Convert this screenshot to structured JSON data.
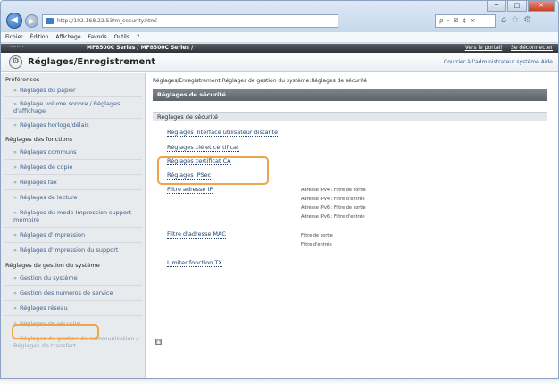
{
  "browser": {
    "url": "http://192.168.22.53/m_security.html",
    "search_text": "ρ - ☒ ¢ ×",
    "window_controls": [
      "─",
      "□",
      "✕"
    ],
    "icons": [
      "home-icon",
      "star-icon",
      "gear-icon"
    ],
    "icon_glyphs": [
      "⌂",
      "☆",
      "⚙"
    ]
  },
  "menu": [
    "Fichier",
    "Édition",
    "Affichage",
    "Favoris",
    "Outils",
    "?"
  ],
  "brand_bar": {
    "device_name": "········",
    "model": "MF8500C Series / MF8500C Series /",
    "links": [
      "Vers le portail",
      "Se déconnecter"
    ]
  },
  "page_header": {
    "title": "Réglages/Enregistrement",
    "right_text": "Courrier à l'administrateur système  Aide"
  },
  "sidebar": {
    "sections": [
      {
        "title": "Préférences",
        "items": [
          "Réglages du papier",
          "Réglage volume sonore / Réglages d'affichage",
          "Réglages horloge/délais"
        ]
      },
      {
        "title": "Réglages des fonctions",
        "items": [
          "Réglages communs",
          "Réglages de copie",
          "Réglages fax",
          "Réglages de lecture",
          "Réglages du mode Impression support mémoire",
          "Réglages d'impression",
          "Réglages d'impression du support"
        ]
      },
      {
        "title": "Réglages de gestion du système",
        "items": [
          "Gestion du système",
          "Gestion des numéros de service",
          "Réglages réseau",
          "Réglages de sécurité",
          "Réglages de gestion de communication / Réglages de transfert"
        ]
      }
    ]
  },
  "main": {
    "breadcrumb": "Réglages/Enregistrement:Réglages de gestion du système:Réglages de sécurité",
    "header_bar": "Réglages de sécurité",
    "sub_bar": "Réglages de sécurité",
    "links": [
      "Réglages interface utilisateur distante",
      "Réglages clé et certificat",
      "Réglages certificat CA",
      "Réglages IPSec",
      "Filtre adresse IP",
      "Filtre d'adresse MAC",
      "Limiter fonction TX"
    ],
    "ip_filter_values": [
      "Adresse IPv4 : Filtre de sortie",
      "Adresse IPv4 : Filtre d'entrée",
      "Adresse IPv6 : Filtre de sortie",
      "Adresse IPv6 : Filtre d'entrée"
    ],
    "mac_filter_values": [
      "Filtre de sortie",
      "Filtre d'entrée"
    ],
    "top_button": "▲"
  }
}
